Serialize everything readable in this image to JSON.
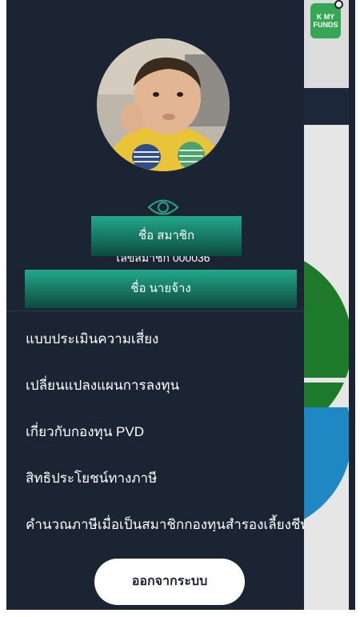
{
  "background_app": {
    "logo_text": "K MY FUNDS"
  },
  "drawer": {
    "member_name_label": "ชื่อ สมาชิก",
    "member_no": "เลขสมาชิก 000036",
    "employer_name_label": "ชื่อ นายจ้าง",
    "menu": [
      {
        "label": "แบบประเมินความเสี่ยง"
      },
      {
        "label": "เปลี่ยนแปลงแผนการลงทุน"
      },
      {
        "label": "เกี่ยวกับกองทุน PVD"
      },
      {
        "label": "สิทธิประโยชน์ทางภาษี"
      },
      {
        "label": "คำนวณภาษีเมื่อเป็นสมาชิกกองทุนสำรองเลี้ยงชีพ"
      }
    ],
    "logout_label": "ออกจากระบบ"
  },
  "colors": {
    "drawer_bg": "#1b2433",
    "accent_green": "#23a88a",
    "pie_green": "#1d7a2a",
    "pie_blue": "#1e88c5"
  },
  "icons": {
    "visibility": "eye-icon"
  }
}
